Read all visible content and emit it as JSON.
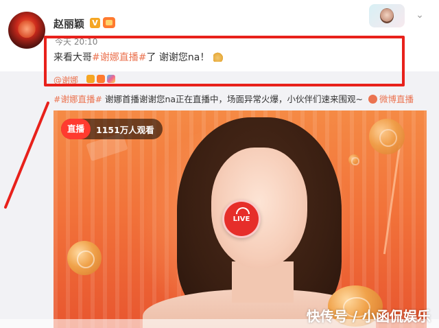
{
  "post": {
    "username": "赵丽颖",
    "verified_badge": "V",
    "time": "今天 20:10",
    "text_prefix": "来看大哥",
    "hashtag": "#谢娜直播#",
    "text_suffix": "了 谢谢您na！"
  },
  "repost": {
    "author": "@谢娜",
    "hashtag": "#谢娜直播#",
    "text": "谢娜首播谢谢您na正在直播中，场面异常火爆，小伙伴们速来围观~",
    "link_label": "微博直播"
  },
  "live_card": {
    "live_tag": "直播",
    "viewer_count": "1151万人观看",
    "live_button_label": "LIVE"
  },
  "watermark": "快传号 / 小函侃娱乐",
  "icons": {
    "dropdown": "chevron-down-icon",
    "verified": "verified-v-icon",
    "vip": "vip-badge-icon",
    "link": "live-link-icon"
  },
  "colors": {
    "highlight": "#e8211b",
    "hashtag": "#eb7350",
    "live_red": "#ff3b2f"
  }
}
